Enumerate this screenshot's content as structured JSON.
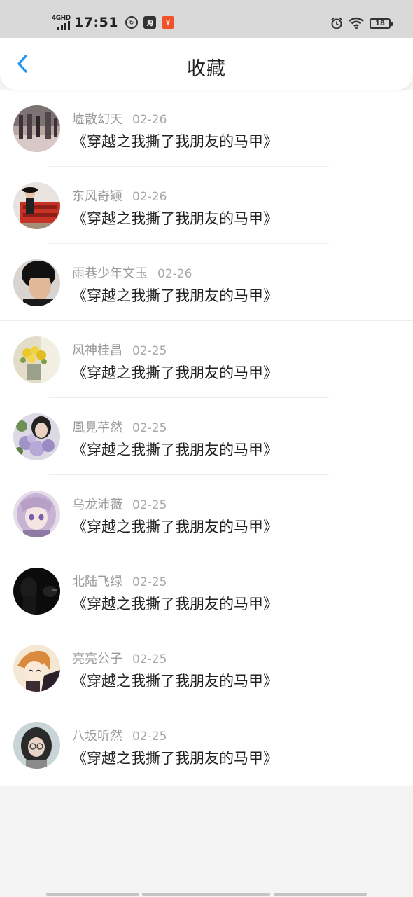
{
  "status_bar": {
    "network": "4GHD",
    "time": "17:51",
    "battery": "18",
    "icons": [
      "sync-icon",
      "taobao-icon",
      "app-notification-icon",
      "alarm-icon",
      "wifi-icon",
      "battery-icon"
    ]
  },
  "header": {
    "title": "收藏",
    "back_icon": "chevron-left-icon",
    "accent_color": "#2196f3"
  },
  "favorites": [
    {
      "name": "墟散幻天",
      "date": "02-26",
      "book": "《穿越之我撕了我朋友的马甲》"
    },
    {
      "name": "东风奇颖",
      "date": "02-26",
      "book": "《穿越之我撕了我朋友的马甲》"
    },
    {
      "name": "雨巷少年文玉",
      "date": "02-26",
      "book": "《穿越之我撕了我朋友的马甲》"
    },
    {
      "name": "风神桂昌",
      "date": "02-25",
      "book": "《穿越之我撕了我朋友的马甲》"
    },
    {
      "name": "風見芊然",
      "date": "02-25",
      "book": "《穿越之我撕了我朋友的马甲》"
    },
    {
      "name": "乌龙沛薇",
      "date": "02-25",
      "book": "《穿越之我撕了我朋友的马甲》"
    },
    {
      "name": "北陆飞绿",
      "date": "02-25",
      "book": "《穿越之我撕了我朋友的马甲》"
    },
    {
      "name": "亮亮公子",
      "date": "02-25",
      "book": "《穿越之我撕了我朋友的马甲》"
    },
    {
      "name": "八坂听然",
      "date": "02-25",
      "book": "《穿越之我撕了我朋友的马甲》"
    }
  ]
}
